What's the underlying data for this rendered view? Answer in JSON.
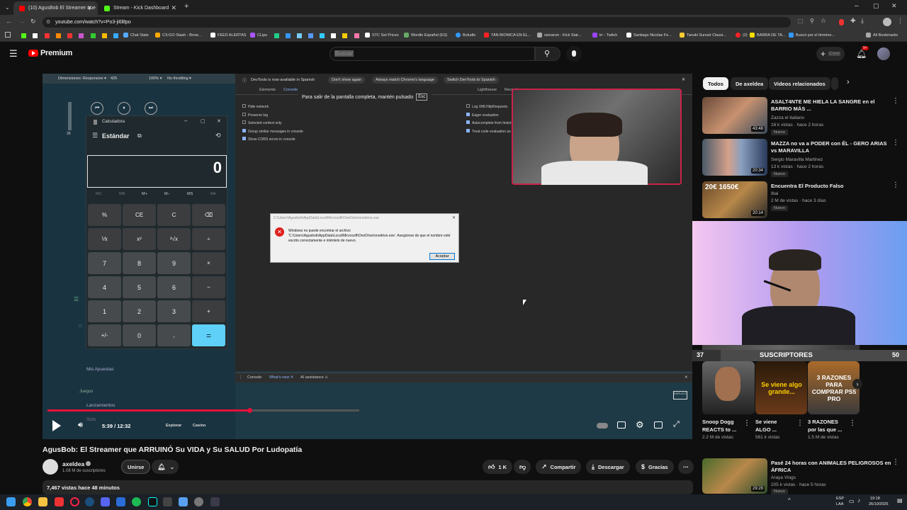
{
  "tabs": [
    {
      "label": "(10) AgusBob El Streamer que",
      "color": "#ff0000"
    },
    {
      "label": "Stream - Kick Dashboard",
      "color": "#53fc18"
    }
  ],
  "address": "youtube.com/watch?v=Po3-ji6l8po",
  "bookmarks": [
    "Chat Stats",
    "CS:GO Stash - Brow...",
    "FEED ALERTAS",
    "CLips",
    "STC Set Prices",
    "Wordle Español (ES)",
    "Boludle",
    "TAN BIONICA EN EL...",
    "sionaron - Kick Stat...",
    "lrr - Twitch",
    "Santiago Nicolas Fe...",
    "Tanuki Sunset Classi...",
    "(2)",
    "BARRA DE TA...",
    "Buscó por el término...",
    "All Bookmarks"
  ],
  "yt": {
    "logo": "Premium",
    "search_placeholder": "Buscar",
    "create_label": "Crear",
    "notif_count": "9+"
  },
  "devtools": {
    "responsive": "Dimensiones: Responsive ▾",
    "width": "425",
    "zoom": "100% ▾",
    "throttle": "No throttling ▾",
    "banner": "DevTools is now available in Spanish",
    "btn_dont": "Don't show again",
    "btn_match": "Always match Chrome's language",
    "btn_switch": "Switch DevTools to Spanish",
    "tabs": [
      "Elements",
      "Console",
      "Sources",
      "Network",
      "Performance",
      "Memory",
      "Application",
      "Privacy and security",
      "Lighthouse",
      "Recorder"
    ],
    "options_left": [
      "Hide network",
      "Preserve log",
      "Selected context only",
      "Group similar messages in console",
      "Show CORS errors in console"
    ],
    "options_right": [
      "Log XMLHttpRequests",
      "Eager evaluation",
      "Autocomplete from history",
      "Treat code evaluation as user action"
    ],
    "drawer_tabs": [
      "Console",
      "What's new ✕",
      "AI assistance ⚠"
    ]
  },
  "fullscreen_hint": {
    "text": "Para salir de la pantalla completa, mantén pulsado",
    "key": "Esc"
  },
  "calc": {
    "title": "Calculadora",
    "mode": "Estándar",
    "display": "0",
    "memory": [
      "MC",
      "MR",
      "M+",
      "M−",
      "MS",
      "M▾"
    ],
    "keys": [
      "%",
      "CE",
      "C",
      "⌫",
      "⅟x",
      "x²",
      "²√x",
      "÷",
      "7",
      "8",
      "9",
      "×",
      "4",
      "5",
      "6",
      "−",
      "1",
      "2",
      "3",
      "+",
      "+/-",
      "0",
      ",",
      "="
    ]
  },
  "error": {
    "title": "C:\\Users\\Agusbob\\AppData\\Local\\Microsoft\\OneDrive\\onedrive.exe",
    "message": "Windows no puede encontrar el archivo 'C:\\Users\\Agusbob\\AppData\\Local\\Microsoft\\OneDrive\\onedrive.exe'. Asegúrese de que el nombre esté escrito correctamente e inténtelo de nuevo.",
    "button": "Aceptar"
  },
  "overlay": {
    "menu1": "Mis Apuestas",
    "menu2": "Juegos",
    "menu3": "Lanzamientos",
    "menu4": "Slots",
    "explore": "Explorar",
    "casino": "Casino",
    "volume_value": "28"
  },
  "subs_bar": {
    "left": "37",
    "label": "SUSCRIPTORES",
    "right": "50"
  },
  "player": {
    "time": "5:39 / 12:32",
    "progress": 0.45
  },
  "video": {
    "title": "AgusBob: El Streamer que ARRUINÓ Su VIDA y Su SALUD Por Ludopatía",
    "channel": "axeldea",
    "subscribers": "1.08 M de suscriptores",
    "join": "Unirse",
    "likes": "1 K",
    "share": "Compartir",
    "download": "Descargar",
    "thanks": "Gracias",
    "views": "7,467 vistas hace 48 minutos"
  },
  "chips": [
    "Todos",
    "De axeldea",
    "Videos relacionados"
  ],
  "related": [
    {
      "title": "ASALT4NTE ME HIELA LA SANGRE en el BARRIO MÁS ...",
      "channel": "Zazza el italiano",
      "meta": "16 k vistas · hace 2 horas",
      "badge": "Nuevo",
      "duration": "43:48"
    },
    {
      "title": "MAZZA no va a PODER con ÉL - GERO ARIAS vs MARAVILLA",
      "channel": "Sergio Maravilla Martinez",
      "meta": "13 k vistas · hace 2 horas",
      "badge": "Nuevo",
      "duration": "20:34"
    },
    {
      "title": "Encuentra El Producto Falso",
      "channel": "Ibai",
      "meta": "2 M de vistas · hace 3 días",
      "badge": "Nuevo",
      "duration": "20:14",
      "thumb_text": "20€ 1650€"
    }
  ],
  "shorts": [
    {
      "title": "Snoop Dogg REACTS to ...",
      "views": "2.2 M de vistas"
    },
    {
      "title": "Se viene ALGO ...",
      "views": "561 k vistas",
      "overlay": "Se viene algo grande..."
    },
    {
      "title": "3 RAZONES por las que ...",
      "views": "1.5 M de vistas",
      "overlay": "3 RAZONES PARA COMPRAR PS5 PRO"
    }
  ],
  "related_bottom": {
    "title": "Pasé 24 horas con ANIMALES PELIGROSOS en ÁFRICA",
    "channel": "Araya Vlogs",
    "meta": "205 k vistas · hace 5 horas",
    "badge": "Nuevo",
    "duration": "29:29"
  },
  "tray": {
    "lang": "ESP",
    "lang2": "LAA",
    "time": "19:18",
    "date": "26/10/2025"
  }
}
